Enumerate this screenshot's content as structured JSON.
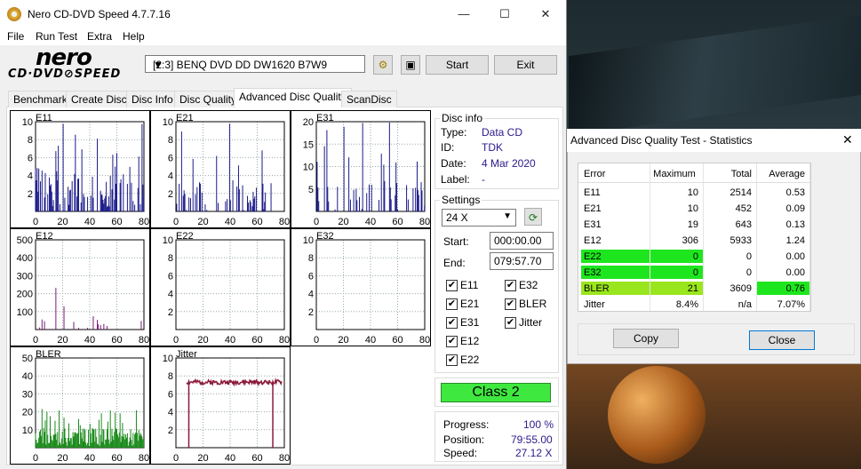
{
  "window": {
    "title": "Nero CD-DVD Speed 4.7.7.16",
    "minimize": "—",
    "maximize": "☐",
    "close": "✕"
  },
  "menu": [
    "File",
    "Run Test",
    "Extra",
    "Help"
  ],
  "logo": {
    "brand": "nero",
    "sub": "CD·DVD⊘SPEED"
  },
  "toolbar": {
    "drive": "[2:3]   BENQ DVD DD DW1620 B7W9",
    "start": "Start",
    "exit": "Exit"
  },
  "tabs": [
    "Benchmark",
    "Create Disc",
    "Disc Info",
    "Disc Quality",
    "Advanced Disc Quality",
    "ScanDisc"
  ],
  "active_tab": 4,
  "disc_info": {
    "group": "Disc info",
    "rows": [
      {
        "label": "Type:",
        "value": "Data CD"
      },
      {
        "label": "ID:",
        "value": "TDK"
      },
      {
        "label": "Date:",
        "value": "4 Mar 2020"
      },
      {
        "label": "Label:",
        "value": "-"
      }
    ]
  },
  "settings": {
    "group": "Settings",
    "speed": "24 X",
    "start_label": "Start:",
    "start": "000:00.00",
    "end_label": "End:",
    "end": "079:57.70",
    "checks": [
      {
        "label": "E11",
        "checked": true
      },
      {
        "label": "E32",
        "checked": true
      },
      {
        "label": "E21",
        "checked": true
      },
      {
        "label": "BLER",
        "checked": true
      },
      {
        "label": "E31",
        "checked": true
      },
      {
        "label": "Jitter",
        "checked": true
      },
      {
        "label": "E12",
        "checked": true
      },
      {
        "label": "E22",
        "checked": true
      }
    ]
  },
  "class_label": "Class 2",
  "progress": {
    "progress_label": "Progress:",
    "progress": "100 %",
    "position_label": "Position:",
    "position": "79:55.00",
    "speed_label": "Speed:",
    "speed": "27.12 X"
  },
  "chart_data": [
    {
      "type": "bar",
      "title": "E11",
      "x": [
        0,
        20,
        40,
        60,
        80
      ],
      "yticks": [
        2,
        4,
        6,
        8,
        10
      ],
      "ylim": [
        0,
        10
      ],
      "color": "#1a1a8a",
      "kind": "dense",
      "seed": 3,
      "level": 0.45
    },
    {
      "type": "bar",
      "title": "E21",
      "x": [
        0,
        20,
        40,
        60,
        80
      ],
      "yticks": [
        2,
        4,
        6,
        8,
        10
      ],
      "ylim": [
        0,
        10
      ],
      "color": "#1a1a8a",
      "kind": "sparse",
      "seed": 7,
      "level": 0.3
    },
    {
      "type": "bar",
      "title": "E31",
      "x": [
        0,
        20,
        40,
        60,
        80
      ],
      "yticks": [
        5,
        10,
        15,
        20
      ],
      "ylim": [
        0,
        20
      ],
      "color": "#1a1a8a",
      "kind": "sparse",
      "seed": 11,
      "level": 0.35
    },
    {
      "type": "bar",
      "title": "E12",
      "x": [
        0,
        20,
        40,
        60,
        80
      ],
      "yticks": [
        100,
        200,
        300,
        400,
        500
      ],
      "ylim": [
        0,
        500
      ],
      "color": "#7a1a7a",
      "kind": "spiky",
      "seed": 5,
      "level": 0.2
    },
    {
      "type": "bar",
      "title": "E22",
      "x": [
        0,
        20,
        40,
        60,
        80
      ],
      "yticks": [
        2,
        4,
        6,
        8,
        10
      ],
      "ylim": [
        0,
        10
      ],
      "color": "#1a1a8a",
      "kind": "empty",
      "seed": 1,
      "level": 0
    },
    {
      "type": "bar",
      "title": "E32",
      "x": [
        0,
        20,
        40,
        60,
        80
      ],
      "yticks": [
        2,
        4,
        6,
        8,
        10
      ],
      "ylim": [
        0,
        10
      ],
      "color": "#1a1a8a",
      "kind": "empty",
      "seed": 1,
      "level": 0
    },
    {
      "type": "bar",
      "title": "BLER",
      "x": [
        0,
        20,
        40,
        60,
        80
      ],
      "yticks": [
        10,
        20,
        30,
        40,
        50
      ],
      "ylim": [
        0,
        50
      ],
      "color": "#1a8a1a",
      "kind": "bler",
      "seed": 9,
      "level": 0.15
    },
    {
      "type": "line",
      "title": "Jitter",
      "x": [
        0,
        20,
        40,
        60,
        80
      ],
      "yticks": [
        2,
        4,
        6,
        8,
        10
      ],
      "ylim": [
        0,
        10
      ],
      "color": "#8a1a3a",
      "kind": "jitter",
      "seed": 2,
      "level": 0.75
    }
  ],
  "stats": {
    "title": "Advanced Disc Quality Test - Statistics",
    "headers": [
      "Error",
      "Maximum",
      "Total",
      "Average"
    ],
    "rows": [
      {
        "name": "E11",
        "max": "10",
        "total": "2514",
        "avg": "0.53",
        "hl": ""
      },
      {
        "name": "E21",
        "max": "10",
        "total": "452",
        "avg": "0.09",
        "hl": ""
      },
      {
        "name": "E31",
        "max": "19",
        "total": "643",
        "avg": "0.13",
        "hl": ""
      },
      {
        "name": "E12",
        "max": "306",
        "total": "5933",
        "avg": "1.24",
        "hl": ""
      },
      {
        "name": "E22",
        "max": "0",
        "total": "0",
        "avg": "0.00",
        "hl": "green"
      },
      {
        "name": "E32",
        "max": "0",
        "total": "0",
        "avg": "0.00",
        "hl": "green"
      },
      {
        "name": "BLER",
        "max": "21",
        "total": "3609",
        "avg": "0.76",
        "hl": "lime"
      },
      {
        "name": "Jitter",
        "max": "8.4%",
        "total": "n/a",
        "avg": "7.07%",
        "hl": ""
      }
    ],
    "copy": "Copy",
    "close": "Close"
  }
}
